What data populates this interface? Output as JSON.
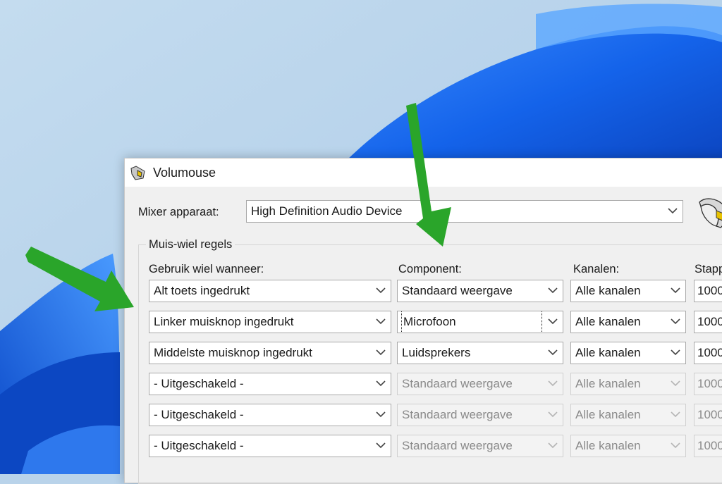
{
  "window": {
    "title": "Volumouse",
    "icon": "volumouse-app-icon"
  },
  "mixer": {
    "label": "Mixer apparaat:",
    "device": "High Definition Audio Device"
  },
  "rules_group": {
    "title": "Muis-wiel regels",
    "headers": {
      "use": "Gebruik wiel wanneer:",
      "component": "Component:",
      "channels": "Kanalen:",
      "steps": "Stapp"
    },
    "rows": [
      {
        "use": "Alt toets ingedrukt",
        "component": "Standaard weergave",
        "channels": "Alle kanalen",
        "steps": "1000",
        "enabled": true
      },
      {
        "use": "Linker muisknop ingedrukt",
        "component": "Microfoon",
        "channels": "Alle kanalen",
        "steps": "1000",
        "enabled": true
      },
      {
        "use": "Middelste muisknop ingedrukt",
        "component": "Luidsprekers",
        "channels": "Alle kanalen",
        "steps": "1000",
        "enabled": true
      },
      {
        "use": "- Uitgeschakeld -",
        "component": "Standaard weergave",
        "channels": "Alle kanalen",
        "steps": "1000",
        "enabled": false
      },
      {
        "use": "- Uitgeschakeld -",
        "component": "Standaard weergave",
        "channels": "Alle kanalen",
        "steps": "1000",
        "enabled": false
      },
      {
        "use": "- Uitgeschakeld -",
        "component": "Standaard weergave",
        "channels": "Alle kanalen",
        "steps": "1000",
        "enabled": false
      }
    ]
  },
  "colors": {
    "arrow": "#2aa52a",
    "wallpaper_blue": "#1f6ff0",
    "wallpaper_bg": "#b9d3ea"
  }
}
